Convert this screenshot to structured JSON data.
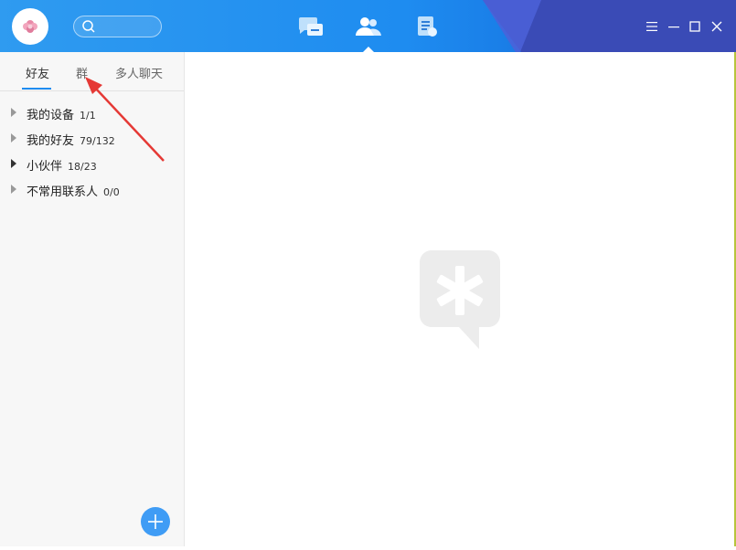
{
  "header": {
    "search": {
      "placeholder": ""
    },
    "nav": [
      {
        "name": "messages",
        "active": false
      },
      {
        "name": "contacts",
        "active": true
      },
      {
        "name": "files",
        "active": false
      }
    ],
    "window_controls": [
      "menu",
      "minimize",
      "maximize",
      "close"
    ]
  },
  "sidebar": {
    "tabs": [
      {
        "label": "好友",
        "active": true
      },
      {
        "label": "群",
        "active": false
      },
      {
        "label": "多人聊天",
        "active": false
      }
    ],
    "groups": [
      {
        "name": "我的设备",
        "count": "1/1"
      },
      {
        "name": "我的好友",
        "count": "79/132"
      },
      {
        "name": "小伙伴",
        "count": "18/23"
      },
      {
        "name": "不常用联系人",
        "count": "0/0"
      }
    ]
  },
  "colors": {
    "accent": "#1e8cf0",
    "annotation_arrow": "#e53935"
  }
}
